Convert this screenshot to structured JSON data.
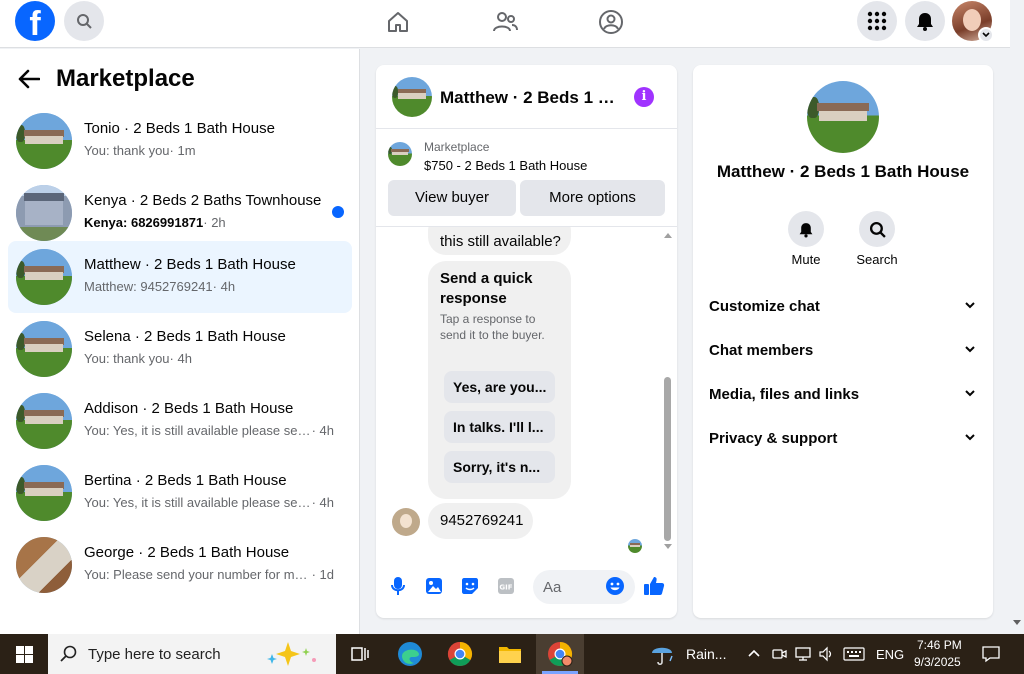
{
  "left": {
    "title": "Marketplace",
    "conversations": [
      {
        "title": "Tonio · 2 Beds 1 Bath House",
        "preview": "You: thank you",
        "time": " · 1m",
        "unread": false
      },
      {
        "title": "Kenya · 2 Beds 2 Baths Townhouse",
        "preview": "Kenya: 6826991871",
        "time": " · 2h",
        "unread": true
      },
      {
        "title": "Matthew · 2 Beds 1 Bath House",
        "preview": "Matthew: 9452769241",
        "time": " · 4h",
        "unread": false
      },
      {
        "title": "Selena · 2 Beds 1 Bath House",
        "preview": "You: thank you",
        "time": " · 4h",
        "unread": false
      },
      {
        "title": "Addison · 2 Beds 1 Bath House",
        "preview": "You: Yes, it is still available please sen...",
        "time": " · 4h",
        "unread": false
      },
      {
        "title": "Bertina · 2 Beds 1 Bath House",
        "preview": "You: Yes, it is still available please sen...",
        "time": " · 4h",
        "unread": false
      },
      {
        "title": "George · 2 Beds 1 Bath House",
        "preview": "You: Please send your number for mo...",
        "time": " · 1d",
        "unread": false
      }
    ]
  },
  "chat": {
    "header_name": "Matthew · 2 Beds 1 B...",
    "listing_label": "Marketplace",
    "listing_price": "$750 - 2 Beds 1 Bath House",
    "view_buyer": "View buyer",
    "more_options": "More options",
    "first_bubble": "this still available?",
    "quick_title": "Send a quick response",
    "quick_desc": "Tap a response to send it to the buyer.",
    "quick_replies": [
      "Yes, are you...",
      "In talks. I'll l...",
      "Sorry, it's n..."
    ],
    "last_message": "9452769241",
    "composer_placeholder": "Aa"
  },
  "right": {
    "name": "Matthew · 2 Beds 1 Bath House",
    "mute": "Mute",
    "search": "Search",
    "sections": [
      "Customize chat",
      "Chat members",
      "Media, files and links",
      "Privacy & support"
    ]
  },
  "taskbar": {
    "search_text": "Type here to search",
    "weather": "Rain...",
    "lang": "ENG",
    "time": "7:46 PM",
    "date": "9/3/2025"
  },
  "colors": {
    "brand": "#0866ff",
    "info": "#a033ff",
    "unread": "#0866ff"
  }
}
